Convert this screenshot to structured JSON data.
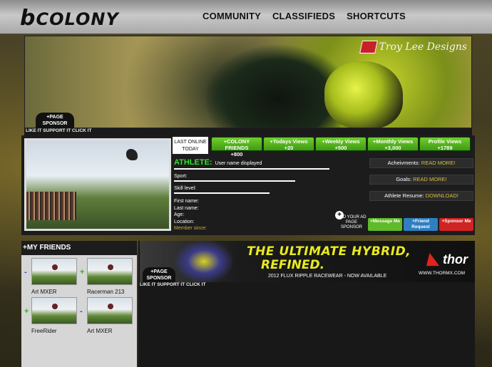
{
  "brand": {
    "logo_text": "COLONY",
    "logo_initial": "b"
  },
  "nav": [
    "COMMUNITY",
    "CLASSIFIEDS",
    "SHORTCUTS"
  ],
  "banner": {
    "sponsor_logo": "Troy Lee Designs",
    "page_sponsor_badge": "+PAGE SPONSOR",
    "like_text": "LIKE IT SUPPORT IT CLICK IT"
  },
  "profile": {
    "last_online": "LAST ONLINE TODAY",
    "stats": [
      {
        "label": "+COLONY FRIENDS",
        "value": "+800"
      },
      {
        "label": "+Todays Views",
        "value": "+20"
      },
      {
        "label": "+Weekly Views",
        "value": "+500"
      },
      {
        "label": "+Monthly Views",
        "value": "+3,000"
      },
      {
        "label": "Profile Views",
        "value": "+1789"
      }
    ],
    "athlete_label": "ATHLETE:",
    "user_name": "User name displayed",
    "fields": {
      "sport": "Sport:",
      "skill": "Skill level:",
      "first_name": "First name:",
      "last_name": "Last name:",
      "age": "Age:",
      "location": "Location:",
      "member_since": "Member since:"
    },
    "side_links": [
      {
        "label": "Acheivments:",
        "link": "READ MORE!"
      },
      {
        "label": "Goals:",
        "link": "READ MORE!"
      },
      {
        "label": "Athlete Resume:",
        "link": "DOWNLOAD!"
      }
    ],
    "add_ad": "ADD YOUR AD PAGE SPONSOR",
    "add_ad_plus": "+",
    "actions": {
      "message": "+Message Me",
      "friend": "+Friend Request",
      "sponsor": "+Sponsor Me"
    }
  },
  "friends": {
    "header": "+MY FRIENDS",
    "items": [
      {
        "name": "Art MXER",
        "mark": "-"
      },
      {
        "name": "Racerman 213",
        "mark": "+"
      },
      {
        "name": "FreeRider",
        "mark": "+"
      },
      {
        "name": "Art MXER",
        "mark": "-"
      }
    ]
  },
  "ad": {
    "headline1": "THE ULTIMATE HYBRID,",
    "headline2": "REFINED.",
    "sub": "2012 FLUX RIPPLE RACEWEAR - NOW AVAILABLE",
    "brand": "thor",
    "url": "WWW.THORMX.COM",
    "sponsor_badge": "+PAGE SPONSOR",
    "like_text": "LIKE IT SUPPORT IT CLICK IT"
  }
}
